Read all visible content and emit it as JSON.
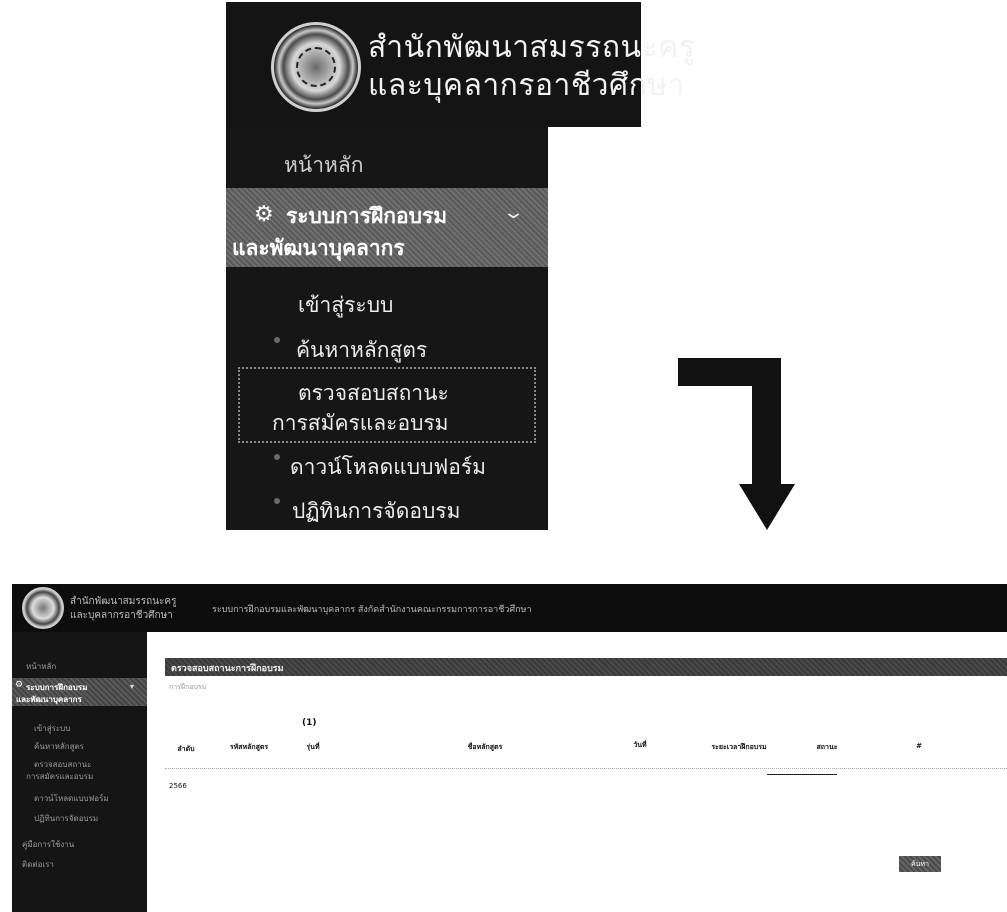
{
  "zoom_panel": {
    "org_name_line1": "สำนักพัฒนาสมรรถนะครู",
    "org_name_line2": "และบุคลากรอาชีวศึกษา",
    "menu": {
      "home": "หน้าหลัก",
      "active_group_line1": "ระบบการฝึกอบรม",
      "active_group_line2": "และพัฒนาบุคลากร",
      "sub_items": [
        "เข้าสู่ระบบ",
        "ค้นหาหลักสูตร",
        "ตรวจสอบสถานะ",
        "การสมัครและอบรม",
        "ดาวน์โหลดแบบฟอร์ม",
        "ปฏิทินการจัดอบรม"
      ]
    }
  },
  "screen": {
    "brand_line1": "สำนักพัฒนาสมรรถนะครู",
    "brand_line2": "และบุคลากรอาชีวศึกษา",
    "system_title": "ระบบการฝึกอบรมและพัฒนาบุคลากร สังกัดสำนักงานคณะกรรมการการอาชีวศึกษา",
    "sidebar": {
      "home": "หน้าหลัก",
      "active_line1": "ระบบการฝึกอบรม",
      "active_line2": "และพัฒนาบุคลากร",
      "items": [
        "เข้าสู่ระบบ",
        "ค้นหาหลักสูตร",
        "ตรวจสอบสถานะ",
        "การสมัครและอบรม",
        "ดาวน์โหลดแบบฟอร์ม",
        "ปฏิทินการจัดอบรม",
        "คู่มือการใช้งาน",
        "ติดต่อเรา"
      ]
    },
    "panel_title": "ตรวจสอบสถานะการฝึกอบรม",
    "panel_sub": "การฝึกอบรม",
    "count_value": "(1)",
    "table_headers": [
      "ลำดับ",
      "รหัสหลักสูตร",
      "รุ่นที่",
      "ชื่อหลักสูตร",
      "วันที่",
      "ระยะเวลาฝึกอบรม",
      "สถานะ",
      "#"
    ],
    "first_cell": "2566",
    "btn_search": "ค้นหา"
  },
  "colors": {
    "dark_header": "#141414",
    "sidebar_bg": "#161616",
    "active_item": "#6a6a6a",
    "arrow": "#111111"
  },
  "icons": {
    "gear": "gear-icon",
    "chevron": "chevron-down-icon",
    "arrow": "down-arrow-icon",
    "logo": "emblem-logo"
  }
}
